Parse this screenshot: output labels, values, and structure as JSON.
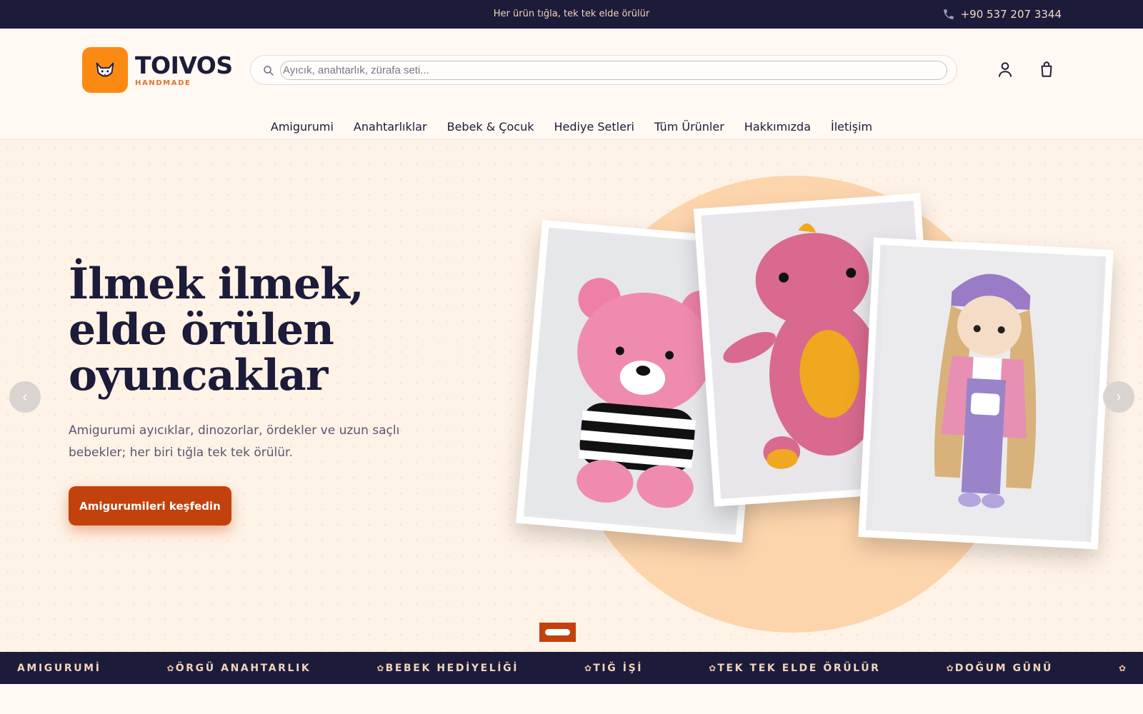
{
  "topbar": {
    "message": "Her ürün tığla, tek tek elde örülür",
    "phone": "+90 537 207 3344"
  },
  "brand": {
    "name": "TOIVOS",
    "tagline": "HANDMADE",
    "accent": "#fb8a12"
  },
  "search": {
    "placeholder": "Ayıcık, anahtarlık, zürafa seti...",
    "value": ""
  },
  "nav": {
    "items": [
      "Amigurumi",
      "Anahtarlıklar",
      "Bebek & Çocuk",
      "Hediye Setleri",
      "Tüm Ürünler",
      "Hakkımızda",
      "İletişim"
    ]
  },
  "hero": {
    "title": "İlmek ilmek, elde örülen oyuncaklar",
    "subtitle": "Amigurumi ayıcıklar, dinozorlar, ördekler ve uzun saçlı bebekler; her biri tığla tek tek örülür.",
    "cta": "Amigurumileri keşfedin",
    "prev": "‹",
    "next": "›",
    "slide_index": 1,
    "slide_count": 1
  },
  "ticker": {
    "items": [
      "AMIGURUMİ",
      "ÖRGÜ ANAHTARLIK",
      "BEBEK HEDİYELİĞİ",
      "TIĞ İŞİ",
      "TEK TEK ELDE ÖRÜLÜR",
      "DOĞUM GÜNÜ"
    ],
    "separator": "✿"
  },
  "colors": {
    "navy": "#1c1b3a",
    "cta": "#c2410c",
    "hero_bg": "#fff2e6"
  }
}
